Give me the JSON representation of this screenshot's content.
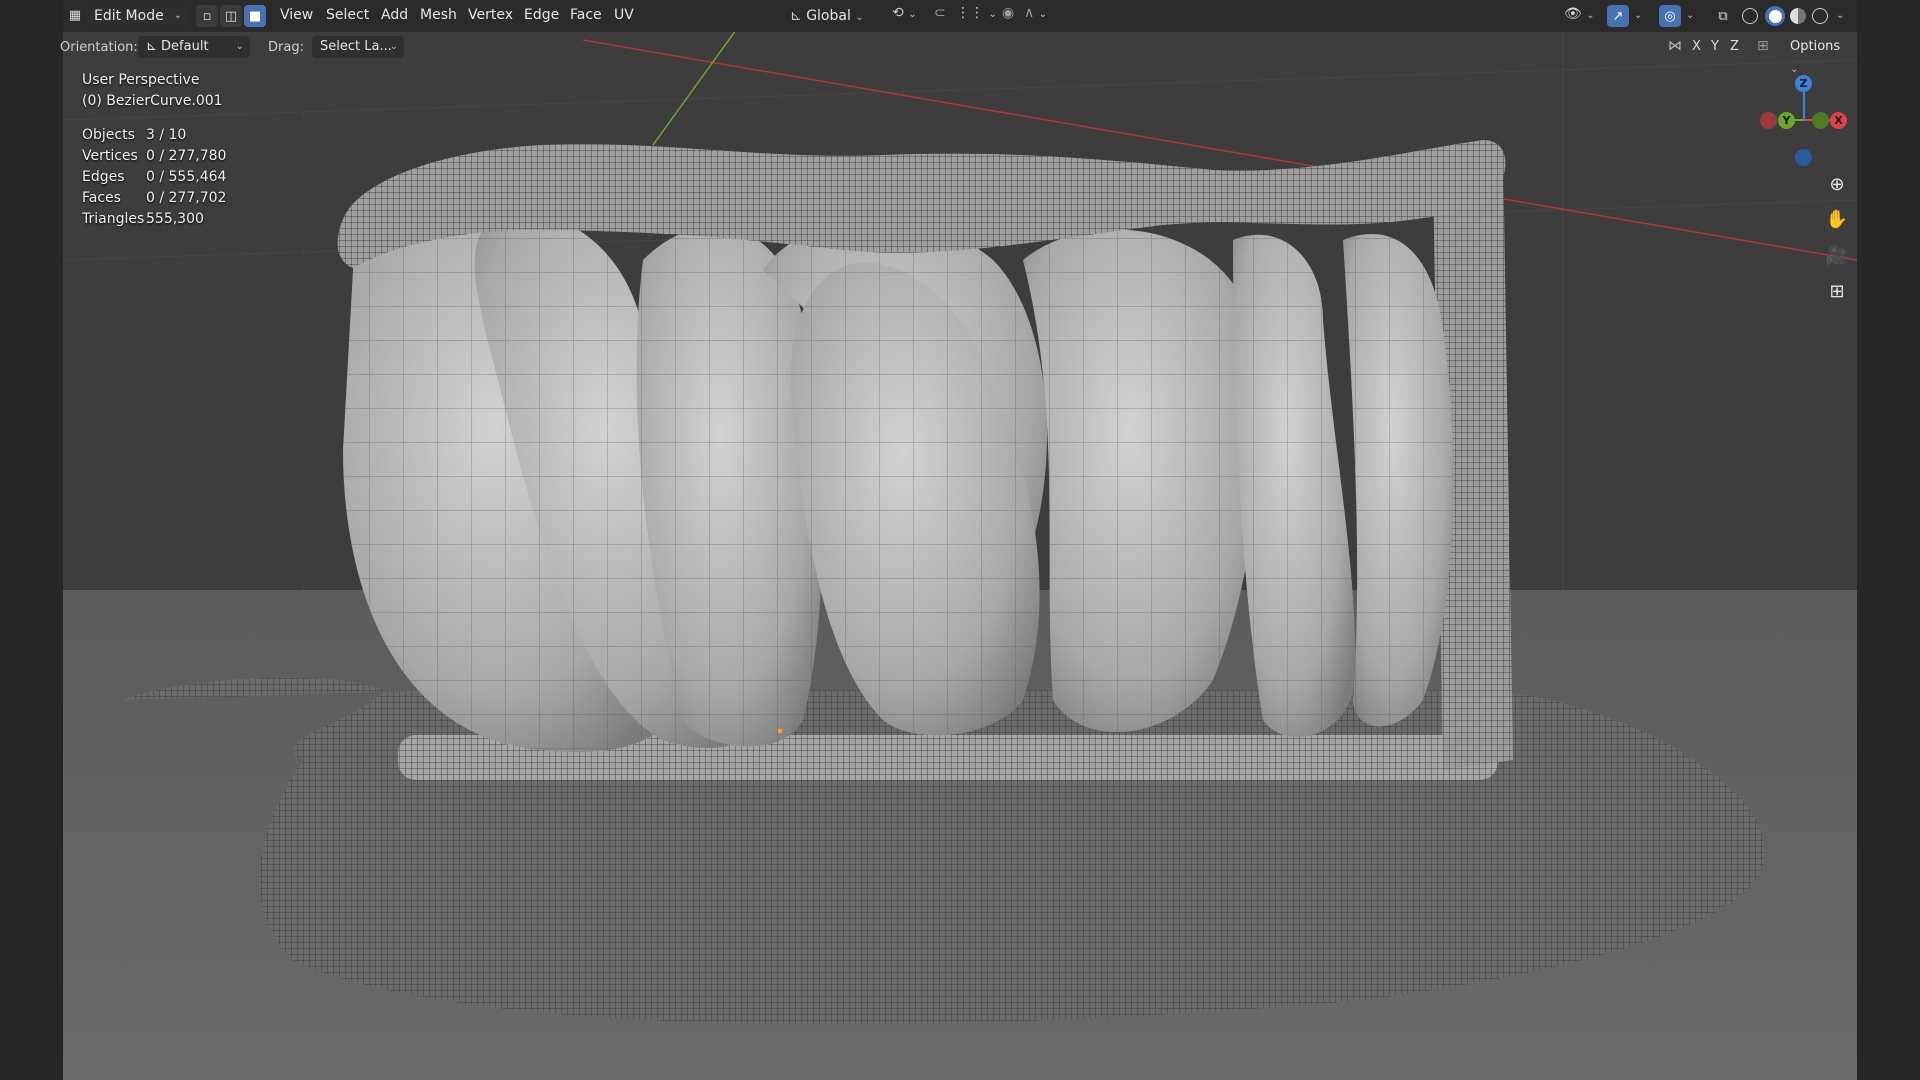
{
  "header": {
    "mode_label": "Edit Mode",
    "menus": [
      "View",
      "Select",
      "Add",
      "Mesh",
      "Vertex",
      "Edge",
      "Face",
      "UV"
    ],
    "transform_orientation": "Global",
    "options_label": "Options"
  },
  "toolrow": {
    "orientation_label": "Orientation:",
    "orientation_value": "Default",
    "drag_label": "Drag:",
    "drag_value": "Select La...",
    "axis_x": "X",
    "axis_y": "Y",
    "axis_z": "Z"
  },
  "overlay": {
    "view_name": "User Perspective",
    "object_name": "(0) BezierCurve.001",
    "stats": [
      {
        "label": "Objects",
        "value": "3 / 10"
      },
      {
        "label": "Vertices",
        "value": "0 / 277,780"
      },
      {
        "label": "Edges",
        "value": "0 / 555,464"
      },
      {
        "label": "Faces",
        "value": "0 / 277,702"
      },
      {
        "label": "Triangles",
        "value": "555,300"
      }
    ]
  },
  "gizmo": {
    "z_label": "Z",
    "y_label": "Y",
    "x_label": "X"
  },
  "icons": {
    "zoom": "zoom-icon",
    "pan": "hand-icon",
    "camera": "camera-icon",
    "ortho": "grid-icon"
  },
  "colors": {
    "accent": "#4772b3",
    "axis_x": "#e0424b",
    "axis_y": "#6ba52a",
    "axis_z": "#3b82d8",
    "viewport_bg": "#3d3d3d"
  }
}
